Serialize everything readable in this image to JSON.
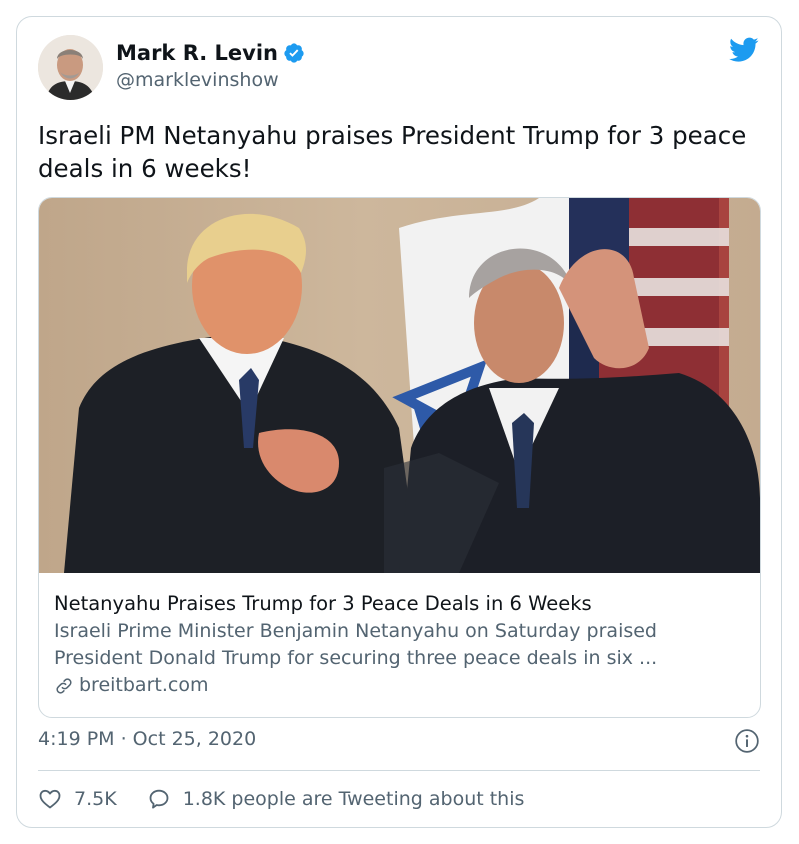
{
  "author": {
    "name": "Mark R. Levin",
    "handle": "@marklevinshow",
    "verified": true
  },
  "tweet": {
    "text": "Israeli PM Netanyahu praises President Trump for 3 peace deals in 6 weeks!",
    "timestamp": "4:19 PM · Oct 25, 2020"
  },
  "card": {
    "title": "Netanyahu Praises Trump for 3 Peace Deals in 6 Weeks",
    "description_line1": "Israeli Prime Minister Benjamin Netanyahu on Saturday praised",
    "description_line2": "President Donald Trump for securing three peace deals in six ...",
    "domain": "breitbart.com"
  },
  "actions": {
    "likes": "7.5K",
    "replies_text": "1.8K people are Tweeting about this"
  },
  "icons": {
    "verified": "verified-badge-icon",
    "brand": "twitter-bird-icon",
    "link": "link-icon",
    "info": "info-icon",
    "like": "heart-icon",
    "reply": "speech-bubble-icon"
  },
  "colors": {
    "brand": "#1d9bf0",
    "text": "#0f1419",
    "secondary": "#536471",
    "border": "#cfd9de"
  }
}
